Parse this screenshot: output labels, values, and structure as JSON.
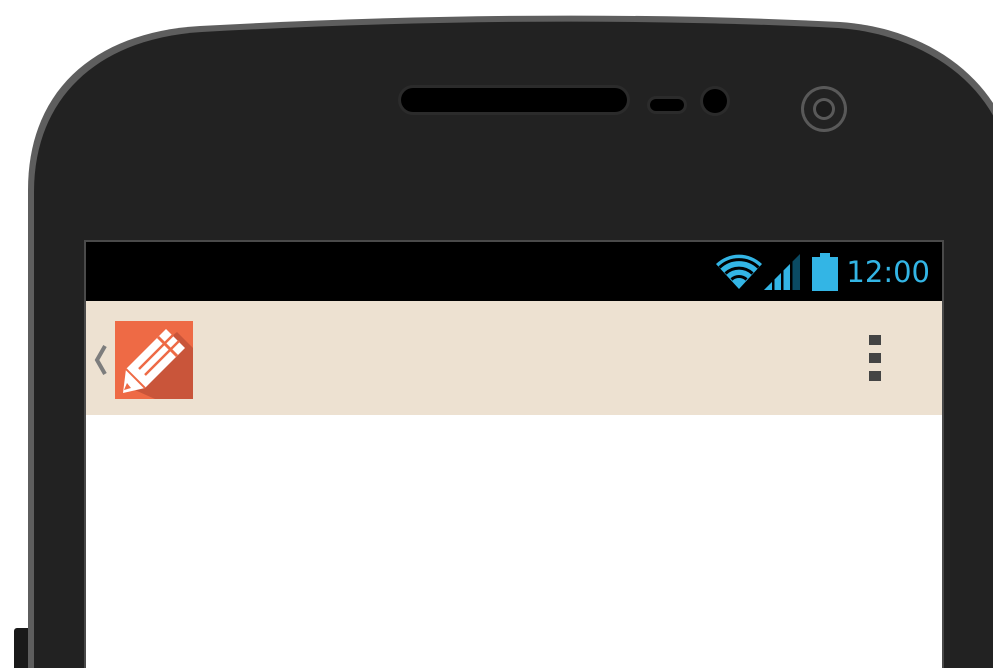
{
  "status_bar": {
    "time": "12:00",
    "icons": [
      "wifi-icon",
      "cell-signal-icon",
      "battery-icon"
    ],
    "accent_color": "#33b5e5"
  },
  "action_bar": {
    "background_color": "#ede1d1",
    "app_icon": "pencil-app-icon",
    "app_icon_color": "#ee6a45",
    "up_icon": "chevron-left-icon",
    "overflow_icon": "overflow-menu-icon"
  },
  "device": {
    "body_color": "#222222"
  }
}
